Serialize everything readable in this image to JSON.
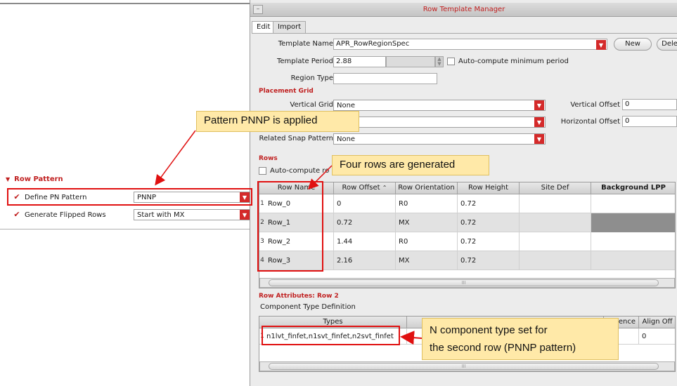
{
  "left_panel": {
    "row_pattern_header": "Row Pattern",
    "define_pn_label": "Define PN Pattern",
    "define_pn_value": "PNNP",
    "flipped_label": "Generate Flipped Rows",
    "flipped_value": "Start with MX"
  },
  "window": {
    "title": "Row Template Manager",
    "tabs": [
      "Edit",
      "Import"
    ]
  },
  "template": {
    "name_label": "Template Name",
    "name_value": "APR_RowRegionSpec",
    "new_button": "New",
    "delete_button": "Delet",
    "period_label": "Template Period",
    "period_value": "2.88",
    "auto_period_label": "Auto-compute minimum period",
    "region_type_label": "Region Type",
    "region_type_value": ""
  },
  "placement_grid": {
    "header": "Placement Grid",
    "vertical_grid_label": "Vertical Grid",
    "vertical_grid_value": "None",
    "related_snap_label": "Related Snap Pattern",
    "related_snap_value": "None",
    "vertical_offset_label": "Vertical Offset",
    "vertical_offset_value": "0",
    "horizontal_offset_label": "Horizontal Offset",
    "horizontal_offset_value": "0"
  },
  "rows": {
    "header": "Rows",
    "auto_compute_label": "Auto-compute ro",
    "columns": [
      "Row Name",
      "Row Offset",
      "Row Orientation",
      "Row Height",
      "Site Def",
      "Background LPP"
    ],
    "data": [
      {
        "idx": "1",
        "name": "Row_0",
        "offset": "0",
        "orientation": "R0",
        "height": "0.72"
      },
      {
        "idx": "2",
        "name": "Row_1",
        "offset": "0.72",
        "orientation": "MX",
        "height": "0.72"
      },
      {
        "idx": "3",
        "name": "Row_2",
        "offset": "1.44",
        "orientation": "R0",
        "height": "0.72"
      },
      {
        "idx": "4",
        "name": "Row_3",
        "offset": "2.16",
        "orientation": "MX",
        "height": "0.72"
      }
    ],
    "scroll_mark": "III"
  },
  "row_attributes": {
    "header": "Row Attributes: Row 2",
    "subheader": "Component Type Definition",
    "columns": [
      "Types",
      "ence",
      "Align Off"
    ],
    "row": {
      "idx": "1",
      "types": "n1lvt_finfet,n1svt_finfet,n2svt_finfet",
      "align": "0"
    },
    "scroll_mark": "III"
  },
  "callouts": {
    "pattern": "Pattern PNNP is applied",
    "rows": "Four rows are generated",
    "ncomp_line1": "N component type set for",
    "ncomp_line2": "the second row (PNNP pattern)"
  },
  "colors": {
    "accent_red": "#d42a2a",
    "callout_bg": "#ffe9a8",
    "annotation_red": "#e01010"
  }
}
